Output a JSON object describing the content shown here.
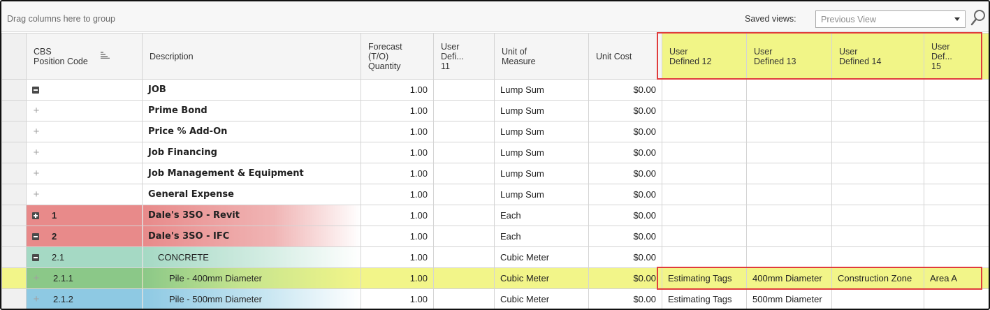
{
  "toolbar": {
    "group_hint": "Drag columns here to group",
    "saved_views_label": "Saved views:",
    "saved_views_value": "Previous View"
  },
  "columns": {
    "cbs": "CBS\nPosition Code",
    "description": "Description",
    "forecast": "Forecast\n(T/O)\nQuantity",
    "ud11": "User\nDefi...\n11",
    "uom": "Unit of\nMeasure",
    "unit_cost": "Unit Cost",
    "ud12": "User\nDefined 12",
    "ud13": "User\nDefined 13",
    "ud14": "User\nDefined 14",
    "ud15": "User\nDef...\n15"
  },
  "rows": [
    {
      "expander": "minus-box",
      "code": "",
      "description": "JOB",
      "quantity": "1.00",
      "ud11": "",
      "uom": "Lump Sum",
      "unit_cost": "$0.00",
      "ud12": "",
      "ud13": "",
      "ud14": "",
      "ud15": ""
    },
    {
      "expander": "plus",
      "code": "",
      "description": "Prime Bond",
      "quantity": "1.00",
      "ud11": "",
      "uom": "Lump Sum",
      "unit_cost": "$0.00",
      "ud12": "",
      "ud13": "",
      "ud14": "",
      "ud15": ""
    },
    {
      "expander": "plus",
      "code": "",
      "description": "Price % Add-On",
      "quantity": "1.00",
      "ud11": "",
      "uom": "Lump Sum",
      "unit_cost": "$0.00",
      "ud12": "",
      "ud13": "",
      "ud14": "",
      "ud15": ""
    },
    {
      "expander": "plus",
      "code": "",
      "description": "Job Financing",
      "quantity": "1.00",
      "ud11": "",
      "uom": "Lump Sum",
      "unit_cost": "$0.00",
      "ud12": "",
      "ud13": "",
      "ud14": "",
      "ud15": ""
    },
    {
      "expander": "plus",
      "code": "",
      "description": "Job Management & Equipment",
      "quantity": "1.00",
      "ud11": "",
      "uom": "Lump Sum",
      "unit_cost": "$0.00",
      "ud12": "",
      "ud13": "",
      "ud14": "",
      "ud15": ""
    },
    {
      "expander": "plus",
      "code": "",
      "description": "General Expense",
      "quantity": "1.00",
      "ud11": "",
      "uom": "Lump Sum",
      "unit_cost": "$0.00",
      "ud12": "",
      "ud13": "",
      "ud14": "",
      "ud15": ""
    },
    {
      "expander": "plus-box",
      "code": "1",
      "description": "Dale's 3SO - Revit",
      "quantity": "1.00",
      "ud11": "",
      "uom": "Each",
      "unit_cost": "$0.00",
      "ud12": "",
      "ud13": "",
      "ud14": "",
      "ud15": ""
    },
    {
      "expander": "minus-box",
      "code": "2",
      "description": "Dale's 3SO - IFC",
      "quantity": "1.00",
      "ud11": "",
      "uom": "Each",
      "unit_cost": "$0.00",
      "ud12": "",
      "ud13": "",
      "ud14": "",
      "ud15": ""
    },
    {
      "expander": "minus-box",
      "code": "2.1",
      "description": "CONCRETE",
      "quantity": "1.00",
      "ud11": "",
      "uom": "Cubic Meter",
      "unit_cost": "$0.00",
      "ud12": "",
      "ud13": "",
      "ud14": "",
      "ud15": ""
    },
    {
      "expander": "plus",
      "code": "2.1.1",
      "description": "Pile - 400mm Diameter",
      "quantity": "1.00",
      "ud11": "",
      "uom": "Cubic Meter",
      "unit_cost": "$0.00",
      "ud12": "Estimating Tags",
      "ud13": "400mm Diameter",
      "ud14": "Construction Zone",
      "ud15": "Area A"
    },
    {
      "expander": "plus",
      "code": "2.1.2",
      "description": "Pile - 500mm Diameter",
      "quantity": "1.00",
      "ud11": "",
      "uom": "Cubic Meter",
      "unit_cost": "$0.00",
      "ud12": "Estimating Tags",
      "ud13": "500mm Diameter",
      "ud14": "",
      "ud15": ""
    }
  ],
  "colors": {
    "highlight_border": "#e03c3c",
    "user_defined_header": "#f1f587",
    "level1_row": "#e88a8a",
    "level2_row": "#a5d9c4",
    "selected_row": "#f2f589",
    "level3_row": "#8ec9e3"
  }
}
